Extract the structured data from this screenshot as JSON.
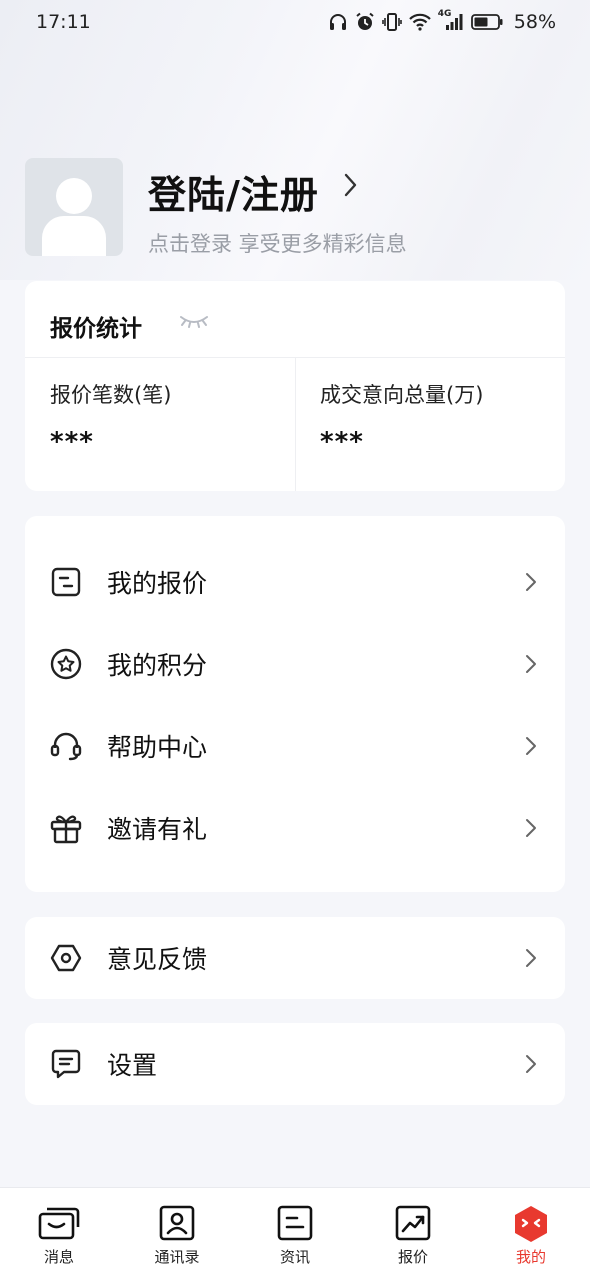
{
  "status_bar": {
    "time": "17:11",
    "battery_percent": "58%",
    "network_type": "4G",
    "icons": [
      "headphones-icon",
      "alarm-icon",
      "vibrate-icon",
      "wifi-icon",
      "signal-icon",
      "battery-icon"
    ]
  },
  "profile": {
    "login_title": "登陆/注册",
    "login_subtitle": "点击登录 享受更多精彩信息"
  },
  "stats": {
    "title": "报价统计",
    "items": [
      {
        "label": "报价笔数(笔)",
        "value": "***"
      },
      {
        "label": "成交意向总量(万)",
        "value": "***"
      }
    ]
  },
  "menu": {
    "items": [
      {
        "label": "我的报价",
        "icon": "quote-list-icon"
      },
      {
        "label": "我的积分",
        "icon": "star-points-icon"
      },
      {
        "label": "帮助中心",
        "icon": "headset-icon"
      },
      {
        "label": "邀请有礼",
        "icon": "gift-icon"
      }
    ]
  },
  "feedback": {
    "label": "意见反馈",
    "icon": "hexagon-feedback-icon"
  },
  "settings": {
    "label": "设置",
    "icon": "settings-message-icon"
  },
  "tabbar": {
    "items": [
      {
        "label": "消息",
        "icon": "messages-icon",
        "active": false
      },
      {
        "label": "通讯录",
        "icon": "contacts-icon",
        "active": false
      },
      {
        "label": "资讯",
        "icon": "news-icon",
        "active": false
      },
      {
        "label": "报价",
        "icon": "quote-chart-icon",
        "active": false
      },
      {
        "label": "我的",
        "icon": "mine-icon",
        "active": true
      }
    ],
    "active_color": "#e8392f"
  }
}
